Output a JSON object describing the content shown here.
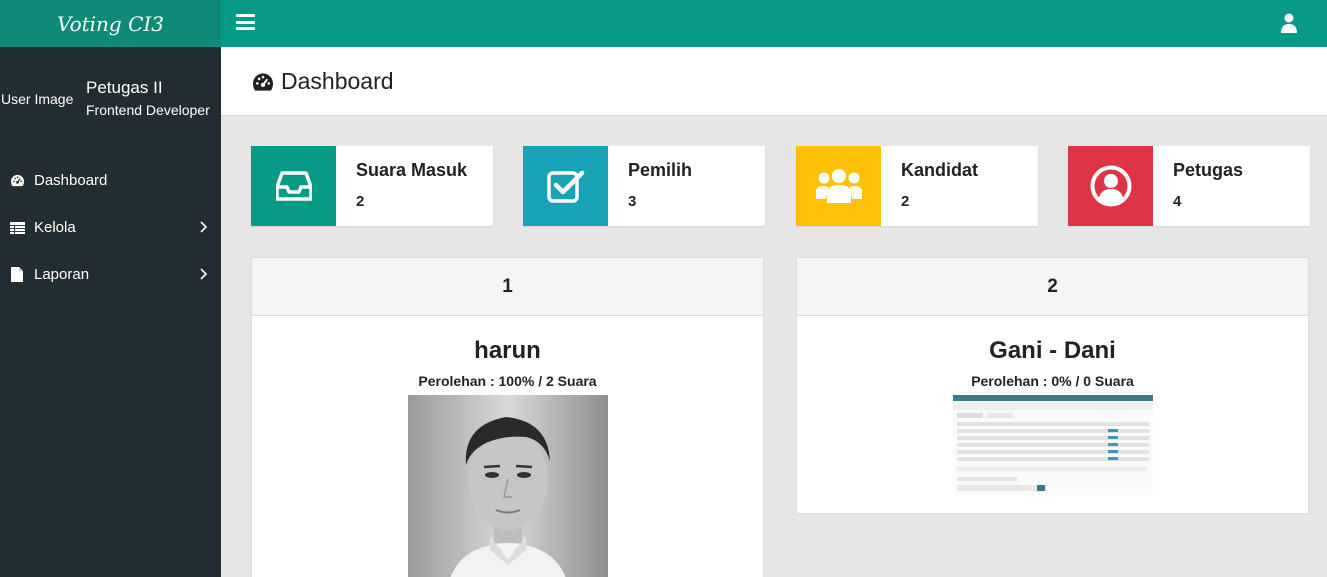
{
  "app": {
    "brand": "Voting CI3"
  },
  "header": {
    "menu_icon": "bars-icon",
    "user_icon": "user-icon"
  },
  "sidebar": {
    "user_image_alt": "User Image",
    "user_name": "Petugas II",
    "user_role": "Frontend Developer",
    "items": [
      {
        "label": "Dashboard",
        "icon": "dashboard-icon"
      },
      {
        "label": "Kelola",
        "icon": "table-icon"
      },
      {
        "label": "Laporan",
        "icon": "file-icon"
      }
    ]
  },
  "page": {
    "title": "Dashboard"
  },
  "stats": [
    {
      "label": "Suara Masuk",
      "value": "2",
      "color": "#079a86",
      "icon": "inbox-icon"
    },
    {
      "label": "Pemilih",
      "value": "3",
      "color": "#17a2b8",
      "icon": "check-square-icon"
    },
    {
      "label": "Kandidat",
      "value": "2",
      "color": "#ffc107",
      "icon": "users-icon"
    },
    {
      "label": "Petugas",
      "value": "4",
      "color": "#dc3545",
      "icon": "user-circle-icon"
    }
  ],
  "candidates": [
    {
      "number": "1",
      "name": "harun",
      "result": "Perolehan : 100% / 2 Suara",
      "photo": "portrait-photo"
    },
    {
      "number": "2",
      "name": "Gani - Dani",
      "result": "Perolehan : 0% / 0 Suara",
      "photo": "screenshot-thumbnail"
    }
  ]
}
